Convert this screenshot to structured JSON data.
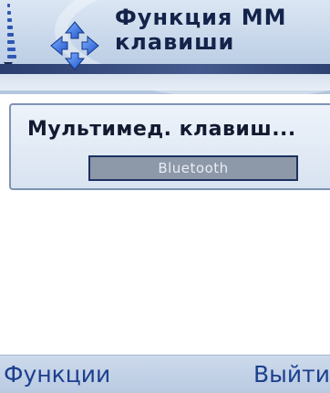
{
  "header": {
    "title_line1": "Функция ММ",
    "title_line2": "клавиши",
    "app_icon": "directional-arrows-icon"
  },
  "setting_item": {
    "label": "Мультимед. клавиш...",
    "value": "Bluetooth"
  },
  "softkeys": {
    "left": "Функции",
    "right": "Выйти"
  },
  "colors": {
    "accent": "#2f58b4",
    "title_text": "#13234a",
    "softkey_text": "#1c3f8e"
  }
}
